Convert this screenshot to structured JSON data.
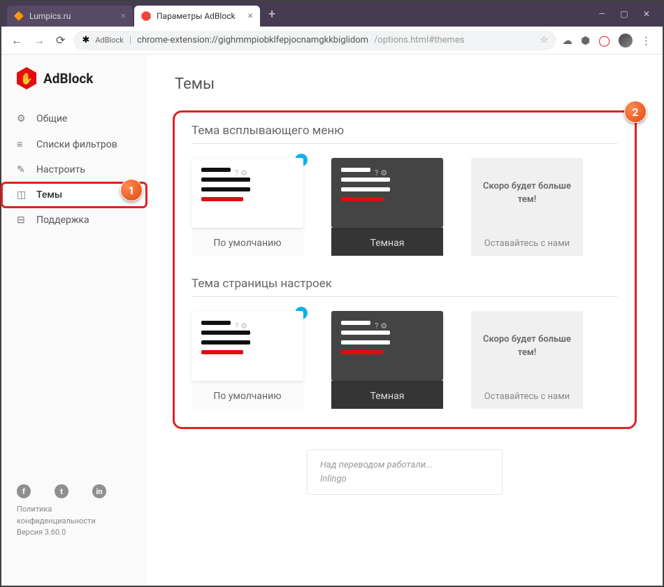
{
  "window": {
    "tabs": [
      {
        "title": "Lumpics.ru",
        "active": false
      },
      {
        "title": "Параметры AdBlock",
        "active": true
      }
    ]
  },
  "addressBar": {
    "extLabel": "AdBlock",
    "host": "chrome-extension://gighmmpiobklfepjocnamgkkbiglidom",
    "path": "/options.html#themes"
  },
  "brandName": "AdBlock",
  "sidebar": {
    "items": [
      {
        "label": "Общие",
        "icon": "⚙"
      },
      {
        "label": "Списки фильтров",
        "icon": "≡"
      },
      {
        "label": "Настроить",
        "icon": "✎"
      },
      {
        "label": "Темы",
        "icon": "◫",
        "active": true
      },
      {
        "label": "Поддержка",
        "icon": "⊟"
      }
    ]
  },
  "footer": {
    "privacy": "Политика конфиденциальности",
    "version": "Версия 3.60.0"
  },
  "pageTitle": "Темы",
  "sections": [
    {
      "title": "Тема всплывающего меню",
      "defaultLabel": "По умолчанию",
      "darkLabel": "Темная",
      "moreTitle": "Скоро будет больше тем!",
      "moreSub": "Оставайтесь с нами"
    },
    {
      "title": "Тема страницы настроек",
      "defaultLabel": "По умолчанию",
      "darkLabel": "Темная",
      "moreTitle": "Скоро будет больше тем!",
      "moreSub": "Оставайтесь с нами"
    }
  ],
  "translator": {
    "line1": "Над переводом работали...",
    "line2": "Inlingo"
  },
  "annotations": {
    "b1": "1",
    "b2": "2"
  }
}
